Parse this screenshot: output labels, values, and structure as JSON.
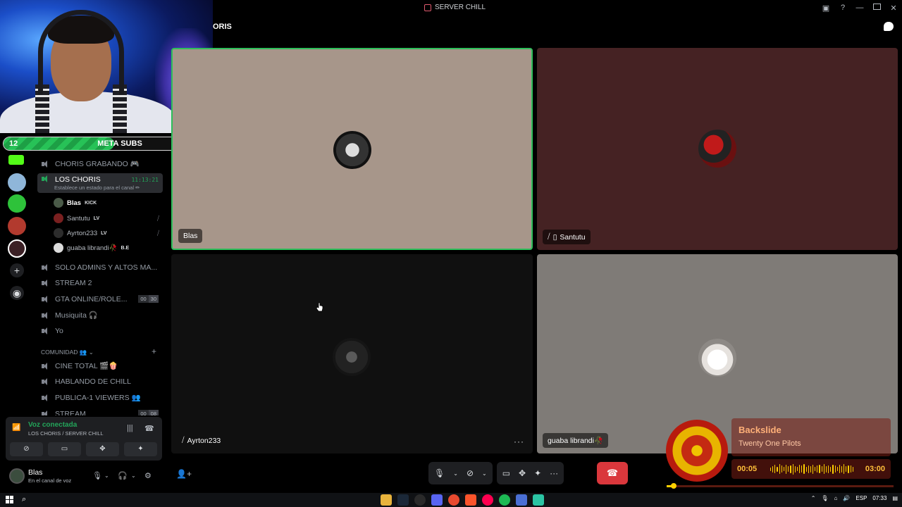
{
  "window": {
    "title": "SERVER CHILL"
  },
  "header": {
    "channel_name": "ORIS"
  },
  "meta_subs": {
    "current": "12",
    "label": "META SUBS",
    "goal": "25",
    "progress_fraction": 0.48
  },
  "channels": {
    "items": [
      {
        "name": "CHORIS GRABANDO 🎮"
      },
      {
        "name": "LOS CHORIS",
        "time": "11:13:21",
        "status_hint": "Establece un estado para el canal ✏"
      },
      {
        "name": "SOLO ADMINS Y ALTOS MA..."
      },
      {
        "name": "STREAM 2"
      },
      {
        "name": "GTA ONLINE/ROLE...",
        "count_a": "00",
        "count_b": "30"
      },
      {
        "name": "Musiquita 🎧"
      },
      {
        "name": "Yo"
      },
      {
        "name": "CINE TOTAL 🎬🍿"
      },
      {
        "name": "HABLANDO DE CHILL"
      },
      {
        "name": "PUBLICA-1 VIEWERS 👥"
      },
      {
        "name": "STREAM",
        "count_a": "00",
        "count_b": "08"
      }
    ],
    "category_community": "COMUNIDAD 👥 ⌄",
    "voice_users": [
      {
        "name": "Blas",
        "tag": "KICK"
      },
      {
        "name": "Santutu",
        "tag": "LV"
      },
      {
        "name": "Ayrton233",
        "tag": "LV"
      },
      {
        "name": "guaba librandi🥀",
        "tag": "B.E"
      }
    ]
  },
  "voice_panel": {
    "status": "Voz conectada",
    "location": "LOS CHORIS / SERVER CHILL"
  },
  "user_panel": {
    "name": "Blas",
    "status": "En el canal de voz"
  },
  "tiles": {
    "blas": "Blas",
    "santutu": "Santutu",
    "ayrton": "Ayrton233",
    "guaba": "guaba librandi🥀"
  },
  "music": {
    "track": "Backslide",
    "artist": "Twenty One Pilots",
    "current": "00:05",
    "duration": "03:00",
    "progress_fraction": 0.03
  },
  "taskbar": {
    "lang": "ESP",
    "clock": "07:33"
  },
  "colors": {
    "speaking_border": "#2dbf5a",
    "hangup": "#da373c",
    "voice_green": "#23a55a",
    "music_accent": "#ffbf3a"
  }
}
